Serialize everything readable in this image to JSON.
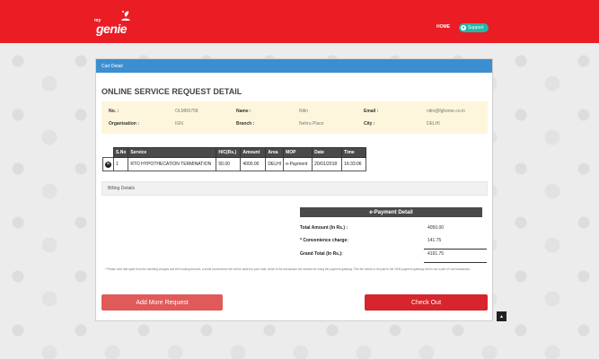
{
  "header": {
    "logo_small": "my",
    "logo_main": "genie",
    "nav_home": "HOME",
    "nav_support": "Support",
    "support_icon": "user-icon"
  },
  "panel": {
    "head_label": "Cart Detail",
    "title": "ONLINE SERVICE REQUEST DETAIL"
  },
  "info": {
    "no_label": "No. :",
    "no_value": "OLMR6758",
    "name_label": "Name :",
    "name_value": "Nitin",
    "email_label": "Email :",
    "email_value": "nitin@fghome.co.in",
    "org_label": "Organisation :",
    "org_value": "IGN",
    "branch_label": "Branch :",
    "branch_value": "Nehru Place",
    "city_label": "City :",
    "city_value": "DELHI"
  },
  "table": {
    "headers": [
      "S.No",
      "Service",
      "H/C(Rs.)",
      "Amount",
      "Area",
      "MOP",
      "Date",
      "Time"
    ],
    "rows": [
      [
        "1",
        "RTO HYPOTHECATION TERMINATION",
        "50.00",
        "4000.00",
        "DELHI",
        "e-Payment",
        "20/01/2018",
        "16:33:06"
      ]
    ],
    "remove_icon": "close-icon"
  },
  "billing": {
    "label": "Billing Details"
  },
  "payment": {
    "heading": "e-Payment Detail",
    "total_label": "Total Amount (In Rs.) :",
    "total_value": "4050.00",
    "conv_label": "* Convenience charge:",
    "conv_value": "141.75",
    "grand_label": "Grand Total (In Rs.):",
    "grand_value": "4191.75"
  },
  "note": "* Please note that apart from the handling charges and the booking amount, a small convenience fee will be added to your total, which is the transaction fee needed for using the payment gateway. This fee needs to be paid to the OEM payment gateway and is not a part of Cart transaction.",
  "buttons": {
    "add_more": "Add More Request",
    "checkout": "Check Out"
  },
  "scroll_top_icon": "chevron-up-icon"
}
